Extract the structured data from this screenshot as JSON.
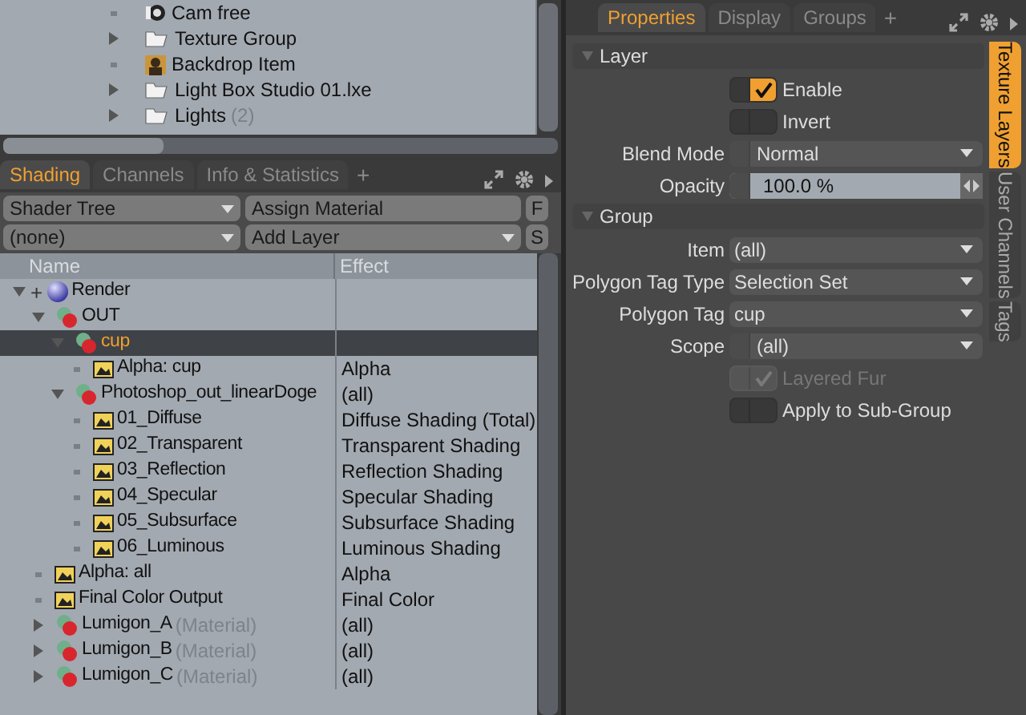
{
  "scene_list": {
    "items": [
      {
        "label": "Cam free",
        "kind": "camera",
        "expandable": false
      },
      {
        "label": "Texture Group",
        "kind": "folder",
        "expandable": true
      },
      {
        "label": "Backdrop Item",
        "kind": "backdrop",
        "expandable": false
      },
      {
        "label": "Light Box Studio 01.lxe",
        "kind": "folder",
        "expandable": true
      },
      {
        "label": "Lights",
        "count": "(2)",
        "kind": "folder",
        "expandable": true
      }
    ]
  },
  "shading_panel": {
    "tabs": [
      {
        "label": "Shading",
        "selected": true
      },
      {
        "label": "Channels",
        "selected": false
      },
      {
        "label": "Info & Statistics",
        "selected": false
      }
    ],
    "add_tab": "+",
    "toolbar": [
      [
        {
          "kind": "dropdown",
          "label": "Shader Tree"
        },
        {
          "kind": "button",
          "label": "Assign Material"
        },
        {
          "kind": "key",
          "label": "F"
        }
      ],
      [
        {
          "kind": "dropdown",
          "label": "(none)"
        },
        {
          "kind": "dropdown",
          "label": "Add Layer"
        },
        {
          "kind": "key",
          "label": "S"
        }
      ]
    ],
    "columns": [
      "Name",
      "Effect"
    ],
    "tree": [
      {
        "label": "Render",
        "kind": "render",
        "toggle": "+",
        "expanded": true,
        "selected": false,
        "children": [
          {
            "label": "OUT",
            "kind": "material",
            "expanded": true,
            "selected": false,
            "children": [
              {
                "label": "cup",
                "kind": "material",
                "expanded": true,
                "selected": true,
                "children": [
                  {
                    "label": "Alpha: cup",
                    "kind": "layer",
                    "effect": "Alpha",
                    "selected": false
                  }
                ]
              },
              {
                "label": "Photoshop_out_linearDoge",
                "kind": "material",
                "effect": "(all)",
                "expanded": true,
                "selected": false,
                "children": [
                  {
                    "label": "01_Diffuse",
                    "kind": "layer",
                    "effect": "Diffuse Shading (Total)",
                    "selected": false
                  },
                  {
                    "label": "02_Transparent",
                    "kind": "layer",
                    "effect": "Transparent Shading",
                    "selected": false
                  },
                  {
                    "label": "03_Reflection",
                    "kind": "layer",
                    "effect": "Reflection Shading",
                    "selected": false
                  },
                  {
                    "label": "04_Specular",
                    "kind": "layer",
                    "effect": "Specular Shading",
                    "selected": false
                  },
                  {
                    "label": "05_Subsurface",
                    "kind": "layer",
                    "effect": "Subsurface Shading",
                    "selected": false
                  },
                  {
                    "label": "06_Luminous",
                    "kind": "layer",
                    "effect": "Luminous Shading",
                    "selected": false
                  }
                ]
              }
            ]
          },
          {
            "label": "Alpha: all",
            "kind": "layer",
            "effect": "Alpha",
            "selected": false
          },
          {
            "label": "Final Color Output",
            "kind": "layer",
            "effect": "Final Color",
            "selected": false
          },
          {
            "label": "Lumigon_A",
            "type": "(Material)",
            "kind": "material",
            "effect": "(all)",
            "expanded": false,
            "selected": false
          },
          {
            "label": "Lumigon_B",
            "type": "(Material)",
            "kind": "material",
            "effect": "(all)",
            "expanded": false,
            "selected": false
          },
          {
            "label": "Lumigon_C",
            "type": "(Material)",
            "kind": "material",
            "effect": "(all)",
            "expanded": false,
            "selected": false
          }
        ]
      }
    ]
  },
  "properties_panel": {
    "tabs": [
      {
        "label": "Properties",
        "selected": true
      },
      {
        "label": "Display",
        "selected": false
      },
      {
        "label": "Groups",
        "selected": false
      }
    ],
    "add_tab": "+",
    "sections": [
      {
        "title": "Layer",
        "fields": [
          {
            "kind": "checkbox",
            "label": "Enable",
            "checked": true,
            "disabled": false
          },
          {
            "kind": "checkbox",
            "label": "Invert",
            "checked": false,
            "disabled": false
          },
          {
            "kind": "dropdown",
            "label": "Blend Mode",
            "value": "Normal",
            "toggle_on": false
          },
          {
            "kind": "number",
            "label": "Opacity",
            "value": "100.0 %",
            "toggle_on": false
          }
        ]
      },
      {
        "title": "Group",
        "fields": [
          {
            "kind": "dropdown",
            "label": "Item",
            "value": "(all)"
          },
          {
            "kind": "dropdown",
            "label": "Polygon Tag Type",
            "value": "Selection Set"
          },
          {
            "kind": "dropdown",
            "label": "Polygon Tag",
            "value": "cup"
          },
          {
            "kind": "dropdown",
            "label": "Scope",
            "value": "(all)",
            "toggle_on": false
          },
          {
            "kind": "checkbox",
            "label": "Layered Fur",
            "checked": true,
            "disabled": true
          },
          {
            "kind": "checkbox",
            "label": "Apply to Sub-Group",
            "checked": false,
            "disabled": false
          }
        ]
      }
    ],
    "side_tabs": [
      {
        "label": "Texture Layers",
        "selected": true
      },
      {
        "label": "User Channels",
        "selected": false
      },
      {
        "label": "Tags",
        "selected": false
      }
    ]
  }
}
